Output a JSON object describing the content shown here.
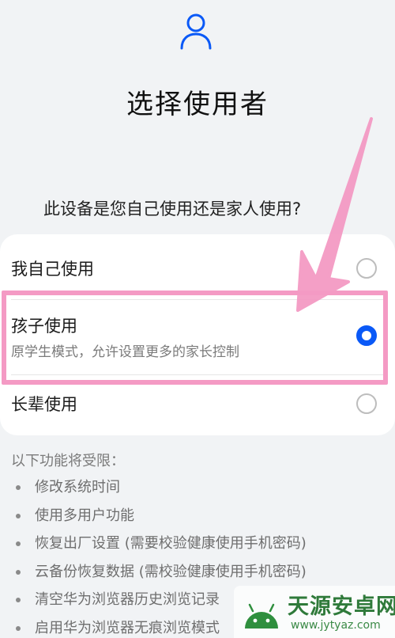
{
  "header": {
    "icon": "user-icon",
    "title": "选择使用者",
    "question": "此设备是您自己使用还是家人使用?"
  },
  "options": [
    {
      "label": "我自己使用",
      "subtitle": "",
      "selected": false
    },
    {
      "label": "孩子使用",
      "subtitle": "原学生模式，允许设置更多的家长控制",
      "selected": true
    },
    {
      "label": "长辈使用",
      "subtitle": "",
      "selected": false
    }
  ],
  "restrictions": {
    "title": "以下功能将受限：",
    "items": [
      "修改系统时间",
      "使用多用户功能",
      "恢复出厂设置 (需要校验健康使用手机密码)",
      "云备份恢复数据 (需校验健康使用手机密码)",
      "清空华为浏览器历史浏览记录",
      "启用华为浏览器无痕浏览模式"
    ]
  },
  "annotation": {
    "highlight_color": "#f49ac4",
    "arrow_color": "#f49ac4"
  },
  "watermark": {
    "name": "天源安卓网",
    "url": "www.jytyaz.com",
    "logo_icon": "android-logo-icon"
  },
  "colors": {
    "accent": "#0a59f7",
    "background": "#f1f3f5"
  }
}
